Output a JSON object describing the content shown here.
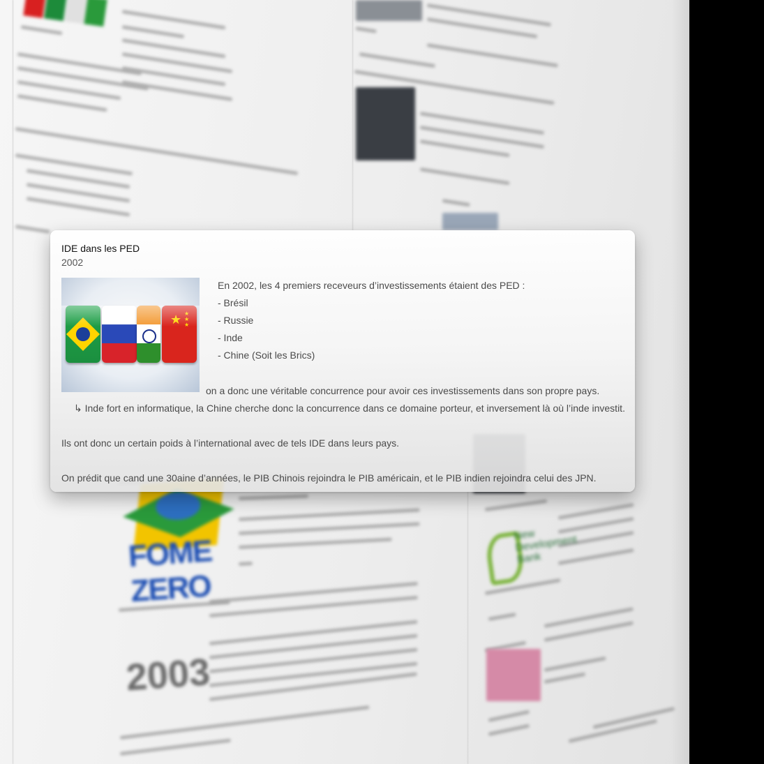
{
  "card": {
    "title": "IDE dans les PED",
    "year": "2002",
    "intro": "En 2002, les 4 premiers receveurs d’investissements étaient des PED :",
    "countries": [
      "- Brésil",
      "- Russie",
      "- Inde",
      "- Chine (Soit les Brics)"
    ],
    "image_label": "BRIC",
    "paragraph_1": "on a donc une véritable concurrence pour avoir ces investissements dans son propre pays.",
    "arrow_line": "↳ Inde fort en informatique, la Chine cherche donc la concurrence dans ce domaine porteur, et inversement là où l’inde investit.",
    "paragraph_2": "Ils ont donc un certain poids à l’international avec de tels IDE dans leurs pays.",
    "paragraph_3": "On prédit que cand une 30aine d’années, le PIB Chinois rejoindra le PIB américain, et le PIB indien rejoindra celui des JPN."
  },
  "background": {
    "logos": {
      "fome_zero": "FOME ZERO",
      "year_2003": "2003",
      "ndb": "New Development Bank"
    }
  },
  "colors": {
    "card_title": "#111111",
    "card_text": "#4a4a4a",
    "page_bg": "#efefef",
    "outside_bg": "#000000"
  }
}
